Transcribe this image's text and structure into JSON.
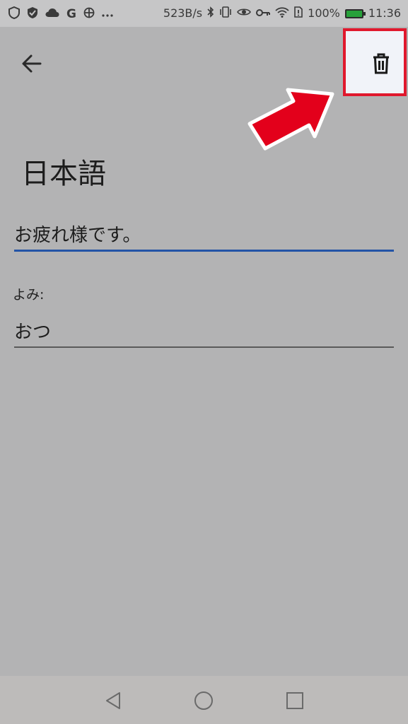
{
  "status_bar": {
    "network_speed": "523B/s",
    "battery_percent": "100%",
    "time": "11:36",
    "left_icons": [
      "shield-outline-icon",
      "shield-check-icon",
      "cloud-icon",
      "google-icon",
      "pinwheel-icon",
      "more-dots-icon"
    ],
    "right_icons": [
      "bluetooth-icon",
      "vibrate-icon",
      "eye-icon",
      "key-icon",
      "wifi-icon",
      "sim-alert-icon",
      "battery-icon"
    ],
    "battery_color": "#27a13a"
  },
  "toolbar": {
    "back_icon": "arrow-left-icon",
    "delete_icon": "trash-icon",
    "highlight_color": "#e0182d"
  },
  "editor": {
    "language_title": "日本語",
    "phrase_value": "お疲れ様です。",
    "reading_label": "よみ:",
    "reading_value": "おつ",
    "active_underline_color": "#2354a6"
  },
  "navigation": {
    "icons": [
      "back-triangle-icon",
      "home-circle-icon",
      "recents-square-icon"
    ]
  }
}
